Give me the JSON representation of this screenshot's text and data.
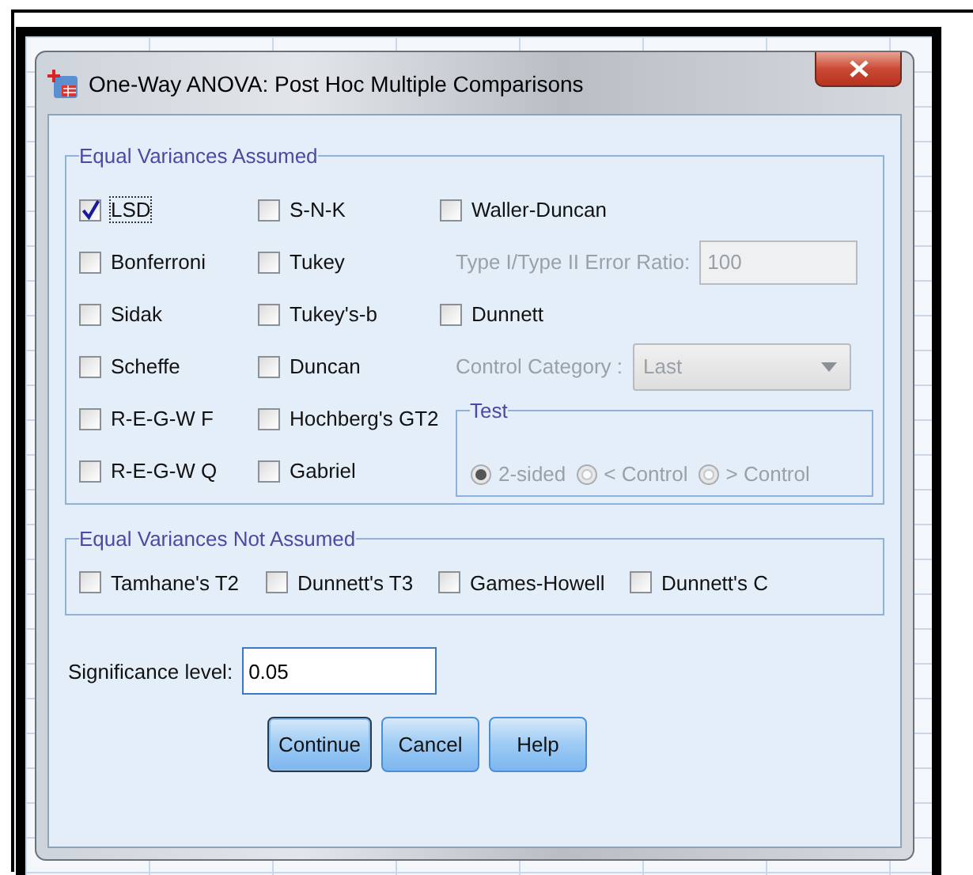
{
  "window": {
    "title": "One-Way ANOVA: Post Hoc Multiple Comparisons"
  },
  "equal_variances_assumed": {
    "title": "Equal Variances Assumed",
    "options": [
      {
        "label": "LSD",
        "checked": true
      },
      {
        "label": "S-N-K",
        "checked": false
      },
      {
        "label": "Bonferroni",
        "checked": false
      },
      {
        "label": "Tukey",
        "checked": false
      },
      {
        "label": "Sidak",
        "checked": false
      },
      {
        "label": "Tukey's-b",
        "checked": false
      },
      {
        "label": "Scheffe",
        "checked": false
      },
      {
        "label": "Duncan",
        "checked": false
      },
      {
        "label": "R-E-G-W F",
        "checked": false
      },
      {
        "label": "Hochberg's GT2",
        "checked": false
      },
      {
        "label": "R-E-G-W Q",
        "checked": false
      },
      {
        "label": "Gabriel",
        "checked": false
      }
    ],
    "waller_duncan": {
      "label": "Waller-Duncan",
      "checked": false
    },
    "error_ratio": {
      "label": "Type I/Type II Error Ratio:",
      "value": "100",
      "disabled": true
    },
    "dunnett": {
      "label": "Dunnett",
      "checked": false
    },
    "control_category": {
      "label": "Control Category :",
      "value": "Last",
      "disabled": true
    },
    "test": {
      "title": "Test",
      "disabled": true,
      "options": [
        {
          "label": "2-sided",
          "selected": true
        },
        {
          "label": "< Control",
          "selected": false
        },
        {
          "label": "> Control",
          "selected": false
        }
      ]
    }
  },
  "equal_variances_not_assumed": {
    "title": "Equal Variances Not Assumed",
    "options": [
      {
        "label": "Tamhane's T2",
        "checked": false
      },
      {
        "label": "Dunnett's T3",
        "checked": false
      },
      {
        "label": "Games-Howell",
        "checked": false
      },
      {
        "label": "Dunnett's C",
        "checked": false
      }
    ]
  },
  "significance": {
    "label": "Significance level:",
    "value": "0.05"
  },
  "buttons": [
    {
      "label": "Continue",
      "default": true
    },
    {
      "label": "Cancel",
      "default": false
    },
    {
      "label": "Help",
      "default": false
    }
  ]
}
